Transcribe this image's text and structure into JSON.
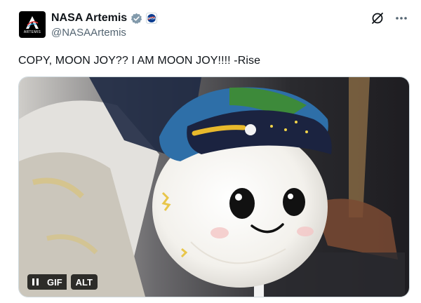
{
  "account": {
    "display_name": "NASA Artemis",
    "handle": "@NASAArtemis",
    "avatar_label": "ARTEMIS"
  },
  "post": {
    "text": "COPY, MOON JOY?? I AM MOON JOY!!!! -Rise"
  },
  "media": {
    "gif_label": "GIF",
    "alt_label": "ALT"
  },
  "icons": {
    "verified": "verified-badge-icon",
    "affiliate": "nasa-affiliate-icon",
    "grok": "grok-icon",
    "more": "more-icon",
    "pause": "pause-icon"
  },
  "colors": {
    "verified_blue": "#1d9bf0",
    "text": "#0f1419",
    "secondary": "#536471"
  }
}
